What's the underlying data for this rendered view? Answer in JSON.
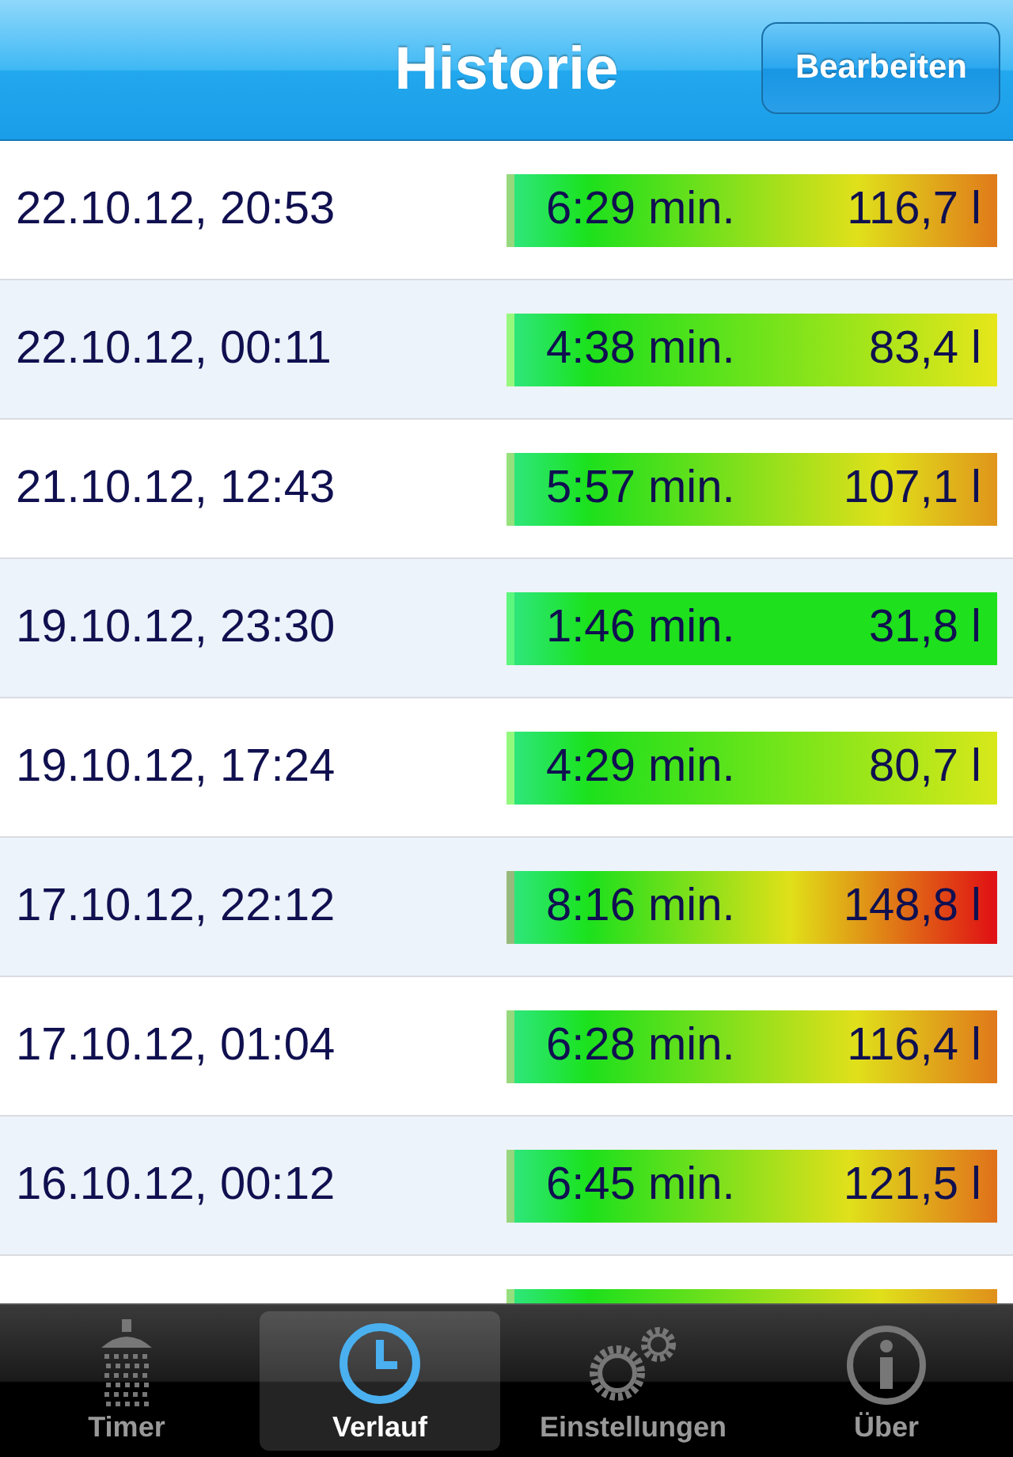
{
  "nav": {
    "title": "Historie",
    "edit_button": "Bearbeiten"
  },
  "rows": [
    {
      "date": "22.10.12, 20:53",
      "duration": "6:29 min.",
      "volume": "116,7 l",
      "color": "#e07a1a"
    },
    {
      "date": "22.10.12, 00:11",
      "duration": "4:38 min.",
      "volume": "83,4 l",
      "color": "#e6e61a"
    },
    {
      "date": "21.10.12, 12:43",
      "duration": "5:57 min.",
      "volume": "107,1 l",
      "color": "#e0951a"
    },
    {
      "date": "19.10.12, 23:30",
      "duration": "1:46 min.",
      "volume": "31,8 l",
      "color": "#1fe01c"
    },
    {
      "date": "19.10.12, 17:24",
      "duration": "4:29 min.",
      "volume": "80,7 l",
      "color": "#d8e81a"
    },
    {
      "date": "17.10.12, 22:12",
      "duration": "8:16 min.",
      "volume": "148,8 l",
      "color": "#e0141a"
    },
    {
      "date": "17.10.12, 01:04",
      "duration": "6:28 min.",
      "volume": "116,4 l",
      "color": "#e0781a"
    },
    {
      "date": "16.10.12, 00:12",
      "duration": "6:45 min.",
      "volume": "121,5 l",
      "color": "#e0701a"
    },
    {
      "color": "#e0901a"
    }
  ],
  "tabs": [
    {
      "kind": "shower",
      "label": "Timer",
      "selected": false
    },
    {
      "kind": "clock",
      "label": "Verlauf",
      "selected": true
    },
    {
      "kind": "gears",
      "label": "Einstellungen",
      "selected": false
    },
    {
      "kind": "info",
      "label": "Über",
      "selected": false
    }
  ]
}
